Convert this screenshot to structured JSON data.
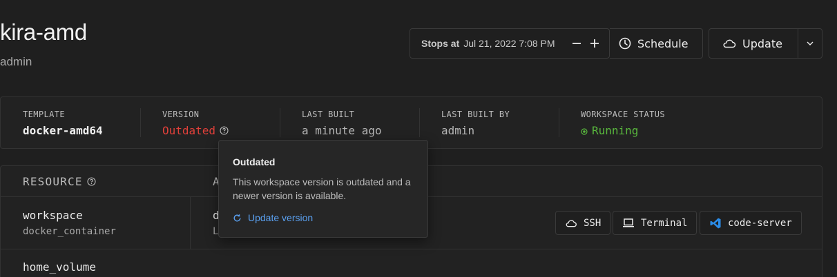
{
  "workspace": {
    "name": "kira-amd",
    "owner": "admin"
  },
  "toolbar": {
    "stops_label": "Stops at",
    "stops_time": "Jul 21, 2022 7:08 PM",
    "schedule_label": "Schedule",
    "update_label": "Update"
  },
  "stats": {
    "template_label": "TEMPLATE",
    "template_value": "docker-amd64",
    "version_label": "VERSION",
    "version_value": "Outdated",
    "last_built_label": "LAST BUILT",
    "last_built_value": "a minute ago",
    "last_built_by_label": "LAST BUILT BY",
    "last_built_by_value": "admin",
    "status_label": "WORKSPACE STATUS",
    "status_value": "Running"
  },
  "resources": {
    "col_resource": "RESOURCE",
    "col_agent": "A",
    "rows": [
      {
        "name": "workspace",
        "type": "docker_container",
        "agent": "d",
        "agent_sub": "L"
      },
      {
        "name": "home_volume"
      }
    ],
    "apps": {
      "ssh": "SSH",
      "terminal": "Terminal",
      "code_server": "code-server"
    }
  },
  "tooltip": {
    "title": "Outdated",
    "body": "This workspace version is outdated and a newer version is available.",
    "link": "Update version"
  },
  "colors": {
    "outdated": "#e0403a",
    "running": "#59b83d",
    "link": "#5aa0f0",
    "vscode": "#2b8ce8"
  }
}
